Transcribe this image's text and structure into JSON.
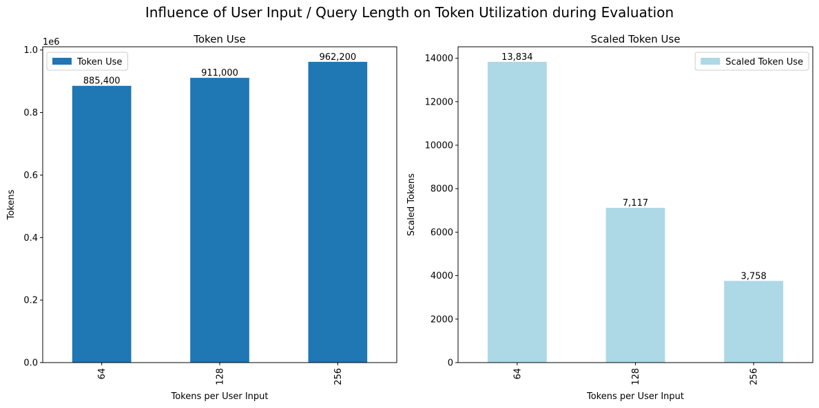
{
  "suptitle": "Influence of User Input / Query Length on Token Utilization during Evaluation",
  "chart_data": [
    {
      "type": "bar",
      "title": "Token Use",
      "xlabel": "Tokens per User Input",
      "ylabel": "Tokens",
      "offset_label": "1e6",
      "categories": [
        "64",
        "128",
        "256"
      ],
      "series": [
        {
          "name": "Token Use",
          "values": [
            885400,
            911000,
            962200
          ],
          "color": "#1f77b4"
        }
      ],
      "data_labels": [
        "885,400",
        "911,000",
        "962,200"
      ],
      "ylim": [
        0,
        1010310
      ],
      "yticks": [
        0,
        200000,
        400000,
        600000,
        800000,
        1000000
      ],
      "ytick_labels": [
        "0.0",
        "0.2",
        "0.4",
        "0.6",
        "0.8",
        "1.0"
      ],
      "legend": "top-left",
      "grid": false
    },
    {
      "type": "bar",
      "title": "Scaled Token Use",
      "xlabel": "Tokens per User Input",
      "ylabel": "Scaled Tokens",
      "categories": [
        "64",
        "128",
        "256"
      ],
      "series": [
        {
          "name": "Scaled Token Use",
          "values": [
            13834,
            7117,
            3758
          ],
          "color": "#add8e6"
        }
      ],
      "data_labels": [
        "13,834",
        "7,117",
        "3,758"
      ],
      "ylim": [
        0,
        14526
      ],
      "yticks": [
        0,
        2000,
        4000,
        6000,
        8000,
        10000,
        12000,
        14000
      ],
      "ytick_labels": [
        "0",
        "2000",
        "4000",
        "6000",
        "8000",
        "10000",
        "12000",
        "14000"
      ],
      "legend": "top-right",
      "grid": false
    }
  ]
}
